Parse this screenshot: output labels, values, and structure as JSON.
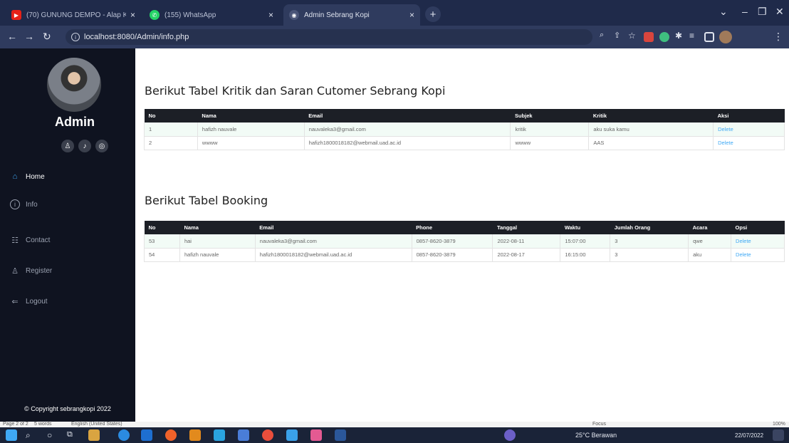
{
  "browser": {
    "tabs": [
      {
        "title": "(70) GUNUNG DEMPO - Alap Ko..."
      },
      {
        "title": "(155) WhatsApp"
      },
      {
        "title": "Admin Sebrang Kopi"
      }
    ],
    "url": "localhost:8080/Admin/info.php"
  },
  "sidebar": {
    "admin_name": "Admin",
    "menu": [
      {
        "label": "Home",
        "icon": "home-icon"
      },
      {
        "label": "Info",
        "icon": "info-icon"
      },
      {
        "label": "Contact",
        "icon": "contact-icon"
      },
      {
        "label": "Register",
        "icon": "register-icon"
      },
      {
        "label": "Logout",
        "icon": "logout-icon"
      }
    ],
    "copyright": "© Copyright sebrangkopi 2022"
  },
  "kritik": {
    "title": "Berikut Tabel Kritik dan Saran Cutomer Sebrang Kopi",
    "headers": [
      "No",
      "Nama",
      "Email",
      "Subjek",
      "Kritik",
      "Aksi"
    ],
    "rows": [
      [
        "1",
        "hafizh nauvale",
        "nauvaleka3@gmail.com",
        "kritik",
        "aku suka kamu",
        "Delete"
      ],
      [
        "2",
        "wwww",
        "hafizh1800018182@webmail.uad.ac.id",
        "wwww",
        "AAS",
        "Delete"
      ]
    ]
  },
  "booking": {
    "title": "Berikut Tabel Booking",
    "headers": [
      "No",
      "Nama",
      "Email",
      "Phone",
      "Tanggal",
      "Waktu",
      "Jumlah Orang",
      "Acara",
      "Opsi"
    ],
    "rows": [
      [
        "53",
        "hai",
        "nauvaleka3@gmail.com",
        "0857-8620-3879",
        "2022-08-11",
        "15:07:00",
        "3",
        "qwe",
        "Delete"
      ],
      [
        "54",
        "hafizh nauvale",
        "hafizh1800018182@webmail.uad.ac.id",
        "0857-8620-3879",
        "2022-08-17",
        "16:15:00",
        "3",
        "aku",
        "Delete"
      ]
    ]
  },
  "statusbar": {
    "page": "Page 2 of 2",
    "words": "5 words",
    "language": "English (United States)",
    "focus": "Focus",
    "zoom": "100%"
  },
  "taskbar": {
    "weather": "25°C Berawan",
    "date": "22/07/2022"
  }
}
